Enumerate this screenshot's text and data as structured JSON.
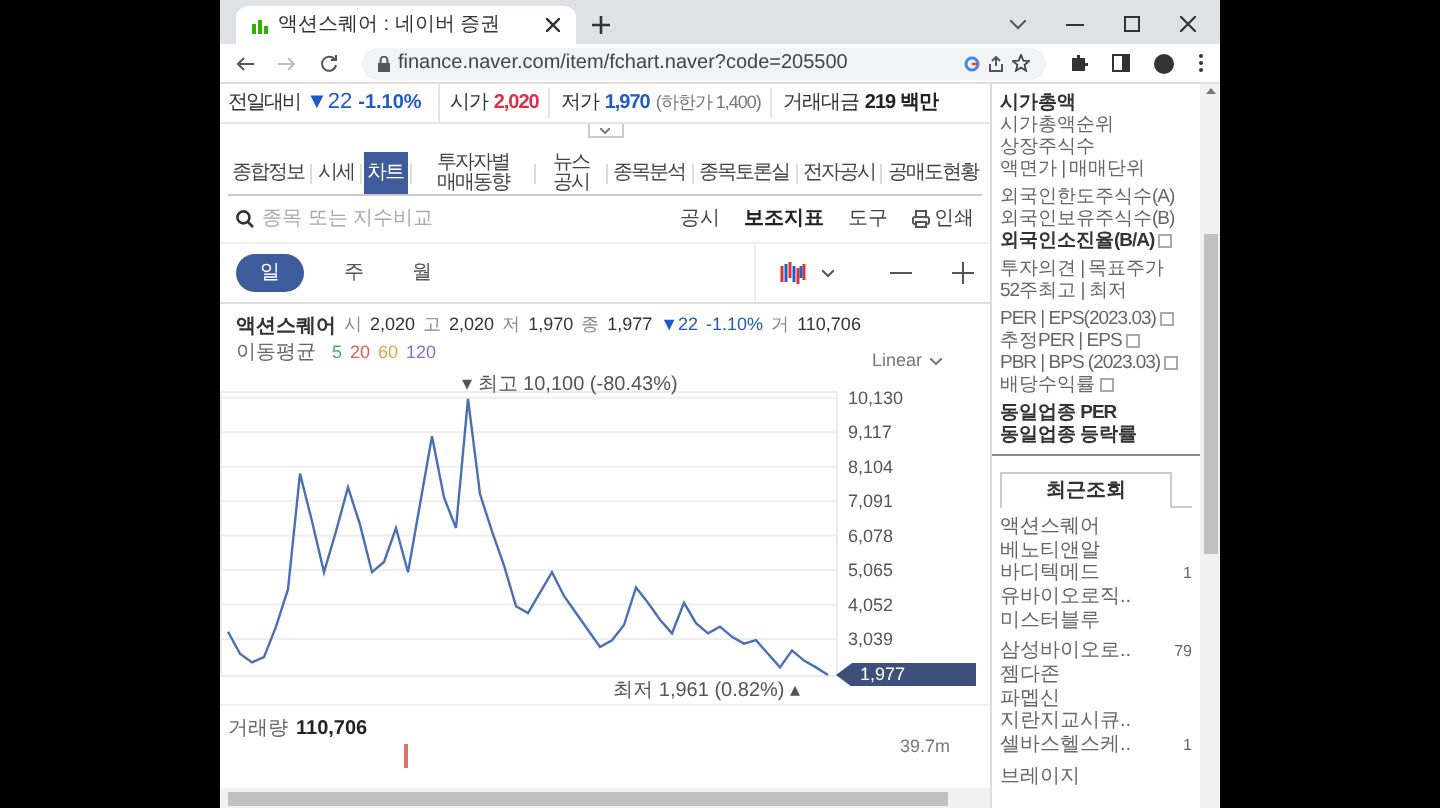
{
  "browser": {
    "tab_title": "액션스퀘어 : 네이버 증권",
    "url": "finance.naver.com/item/fchart.naver?code=205500"
  },
  "summary": {
    "change_label": "전일대비",
    "change": "▼22",
    "change_pct": "-1.10%",
    "fields": [
      {
        "label": "시가",
        "value": "2,020",
        "color": "#d9324a"
      },
      {
        "label": "저가",
        "value": "1,970",
        "color": "#1f5bc6",
        "note": "(하한가 1,400)"
      },
      {
        "label": "거래대금",
        "value": "219 백만",
        "color": "#222222"
      }
    ]
  },
  "nav_tabs": [
    {
      "label": "종합정보",
      "selected": false
    },
    {
      "label": "시세",
      "selected": false
    },
    {
      "label": "차트",
      "selected": true
    },
    {
      "label": "투자자별 매매동향",
      "selected": false
    },
    {
      "label": "뉴스 공시",
      "selected": false
    },
    {
      "label": "종목분석",
      "selected": false
    },
    {
      "label": "종목토론실",
      "selected": false
    },
    {
      "label": "전자공시",
      "selected": false
    },
    {
      "label": "공매도현황",
      "selected": false
    }
  ],
  "compare_search": {
    "placeholder": "종목 또는 지수비교"
  },
  "toolbar": [
    {
      "label": "공시",
      "kind": "plain"
    },
    {
      "label": "보조지표",
      "kind": "bold"
    },
    {
      "label": "도구",
      "kind": "plain"
    },
    {
      "label": "인쇄",
      "kind": "print"
    }
  ],
  "periods": [
    {
      "label": "일",
      "selected": true
    },
    {
      "label": "주",
      "selected": false
    },
    {
      "label": "월",
      "selected": false
    }
  ],
  "quote": {
    "name": "액션스퀘어",
    "items": [
      {
        "label": "시",
        "value": "2,020"
      },
      {
        "label": "고",
        "value": "2,020"
      },
      {
        "label": "저",
        "value": "1,970"
      },
      {
        "label": "종",
        "value": "1,977"
      }
    ],
    "change": "▼22",
    "change_pct": "-1.10%",
    "volume_label": "거",
    "volume": "110,706"
  },
  "moving_average": {
    "label": "이동평균",
    "lines": [
      {
        "label": "5",
        "color": "#4caf50"
      },
      {
        "label": "20",
        "color": "#e05a5a"
      },
      {
        "label": "60",
        "color": "#f0a040"
      },
      {
        "label": "120",
        "color": "#8a6bd1"
      }
    ]
  },
  "scale": "Linear",
  "price_chart": {
    "chart_data": {
      "type": "line",
      "grid": true,
      "ylim": [
        1950,
        10300
      ],
      "series": [
        {
          "color": "#4a6fb5",
          "values": [
            3250,
            2600,
            2350,
            2500,
            3400,
            4500,
            7900,
            6500,
            5000,
            6200,
            7500,
            6400,
            5000,
            5300,
            6300,
            5000,
            7000,
            9000,
            7200,
            6300,
            10100,
            7300,
            6200,
            5200,
            4000,
            3800,
            4400,
            5000,
            4300,
            3800,
            3300,
            2800,
            3000,
            3450,
            4550,
            4100,
            3600,
            3200,
            4100,
            3500,
            3200,
            3400,
            3100,
            2900,
            3000,
            2600,
            2200,
            2700,
            2400,
            2200,
            1980
          ]
        }
      ],
      "yticks": [
        {
          "value": 3039,
          "label": "3,039"
        },
        {
          "value": 4052,
          "label": "4,052"
        },
        {
          "value": 5065,
          "label": "5,065"
        },
        {
          "value": 6078,
          "label": "6,078"
        },
        {
          "value": 7091,
          "label": "7,091"
        },
        {
          "value": 8104,
          "label": "8,104"
        },
        {
          "value": 9117,
          "label": "9,117"
        },
        {
          "value": 10130,
          "label": "10,130"
        }
      ]
    },
    "high_label": "▾ 최고 10,100 (-80.43%)",
    "low_label": "최저 1,961 (0.82%) ▴",
    "current_price": "1,977"
  },
  "volume": {
    "label": "거래량",
    "value": "110,706",
    "axis": "39.7m"
  },
  "sidebar": {
    "groups": [
      [
        {
          "text": "시가총액",
          "bold": true,
          "info": false
        },
        {
          "text": "시가총액순위",
          "bold": false,
          "info": false
        },
        {
          "text": "상장주식수",
          "bold": false,
          "info": false
        },
        {
          "text": "액면가 | 매매단위",
          "bold": false,
          "info": false
        }
      ],
      [
        {
          "text": "외국인한도주식수(A)",
          "bold": false,
          "info": false
        },
        {
          "text": "외국인보유주식수(B)",
          "bold": false,
          "info": false
        },
        {
          "text": "외국인소진율(B/A)",
          "bold": true,
          "info": true
        }
      ],
      [
        {
          "text": "투자의견 | 목표주가",
          "bold": false,
          "info": false
        },
        {
          "text": "52주최고 | 최저",
          "bold": false,
          "info": false
        }
      ],
      [
        {
          "text": "PER | EPS(2023.03)",
          "bold": false,
          "info": true
        },
        {
          "text": "추정PER | EPS",
          "bold": false,
          "info": true
        },
        {
          "text": "PBR | BPS (2023.03)",
          "bold": false,
          "info": true
        },
        {
          "text": "배당수익률",
          "bold": false,
          "info": true
        }
      ],
      [
        {
          "text": "동일업종 PER",
          "bold": true,
          "info": false
        },
        {
          "text": "동일업종 등락률",
          "bold": true,
          "info": false
        }
      ]
    ],
    "recent_tab": "최근조회",
    "recent_groups": [
      [
        {
          "name": "액션스퀘어"
        },
        {
          "name": "베노티앤알"
        },
        {
          "name": "바디텍메드",
          "count": "1"
        },
        {
          "name": "유바이오로직.."
        },
        {
          "name": "미스터블루"
        }
      ],
      [
        {
          "name": "삼성바이오로..",
          "count": "79"
        },
        {
          "name": "젬다존"
        },
        {
          "name": "파멥신"
        },
        {
          "name": "지란지교시큐.."
        },
        {
          "name": "셀바스헬스케..",
          "count": "1"
        }
      ],
      [
        {
          "name": "브레이지"
        }
      ]
    ]
  }
}
